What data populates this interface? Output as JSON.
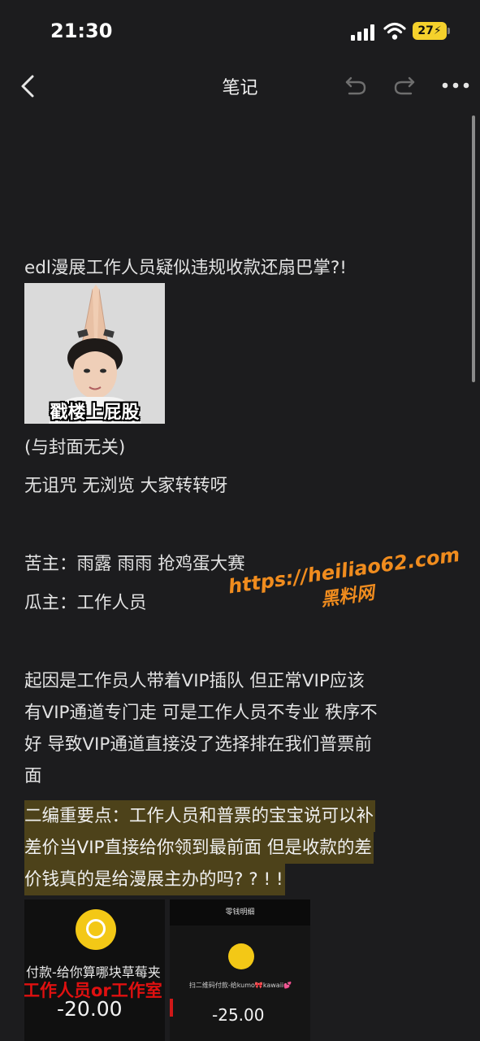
{
  "status_bar": {
    "time": "21:30",
    "battery": "27"
  },
  "header": {
    "title": "笔记"
  },
  "note": {
    "heading": "edl漫展工作人员疑似违规收款还扇巴掌?!",
    "meme_caption": "戳楼上屁股",
    "meme_note": "(与封面无关)",
    "line_curse": "无诅咒 无浏览 大家转转呀",
    "victims": "苦主：雨露  雨雨 抢鸡蛋大赛",
    "subject": "瓜主：工作人员",
    "story_lines": [
      "起因是工作员人带着VIP插队 但正常VIP应该",
      "有VIP通道专门走 可是工作人员不专业 秩序不",
      "好 导致VIP通道直接没了选择排在我们普票前",
      "面"
    ],
    "highlight_lines": [
      "二编重要点：工作人员和普票的宝宝说可以补",
      "差价当VIP直接给你领到最前面 但是收款的差",
      "价钱真的是给漫展主办的吗? ? ! !"
    ]
  },
  "watermark": {
    "url": "https://heiliao62.com",
    "name": "黑料网"
  },
  "screenshots": {
    "left": {
      "desc_text": "付款-给你算哪块草莓夹",
      "red_text": "工作人员or工作室",
      "amount": "-20.00"
    },
    "right": {
      "top_text": "零钱明细",
      "desc_text": "扫二维码付款-给kumo🎀kawaii💕",
      "amount": "-25.00"
    }
  },
  "colors": {
    "background": "#1c1c1e",
    "highlight": "#4d421a",
    "watermark": "#f08c1e",
    "battery": "#f5d12c"
  }
}
